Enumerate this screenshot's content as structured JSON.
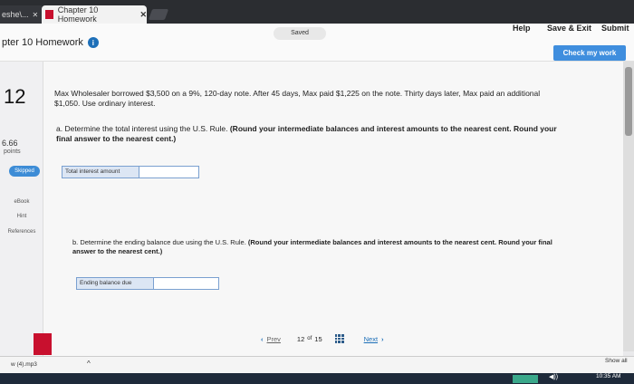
{
  "browser": {
    "prev_tab_label": "eshe\\...",
    "active_tab_label": "Chapter 10 Homework",
    "close_glyph": "✕"
  },
  "header": {
    "assignment_title": "pter 10 Homework",
    "saved_label": "Saved",
    "help_label": "Help",
    "save_exit_label": "Save & Exit",
    "submit_label": "Submit",
    "check_work_label": "Check my work"
  },
  "sidebar": {
    "question_number": "12",
    "points_value": "6.66",
    "points_label": "points",
    "status_badge": "Skipped",
    "links": [
      "eBook",
      "Hint",
      "References"
    ]
  },
  "question": {
    "problem_text": "Max Wholesaler borrowed $3,500 on a 9%, 120-day note. After 45 days, Max paid $1,225 on the note. Thirty days later, Max paid an additional $1,050. Use ordinary interest.",
    "part_a_text": "a. Determine the total interest using the U.S. Rule.",
    "part_a_bold": "(Round your intermediate balances and interest amounts to the nearest cent. Round your final answer to the nearest cent.)",
    "part_a_label": "Total interest amount",
    "part_a_value": "",
    "part_b_text": "b. Determine the ending balance due using the U.S. Rule.",
    "part_b_bold": "(Round your intermediate balances and interest amounts to the nearest cent. Round your final answer to the nearest cent.)",
    "part_b_label": "Ending balance due",
    "part_b_value": ""
  },
  "pager": {
    "prev_label": "Prev",
    "current": "12",
    "of_label": "of",
    "total": "15",
    "next_label": "Next"
  },
  "downloads": {
    "file_label": "w (4).mp3",
    "show_all_label": "Show all"
  },
  "taskbar": {
    "time": "10:35 AM"
  },
  "colors": {
    "accent": "#3f8ede",
    "brand": "#c8102e",
    "skipped": "#3d8cd6"
  }
}
